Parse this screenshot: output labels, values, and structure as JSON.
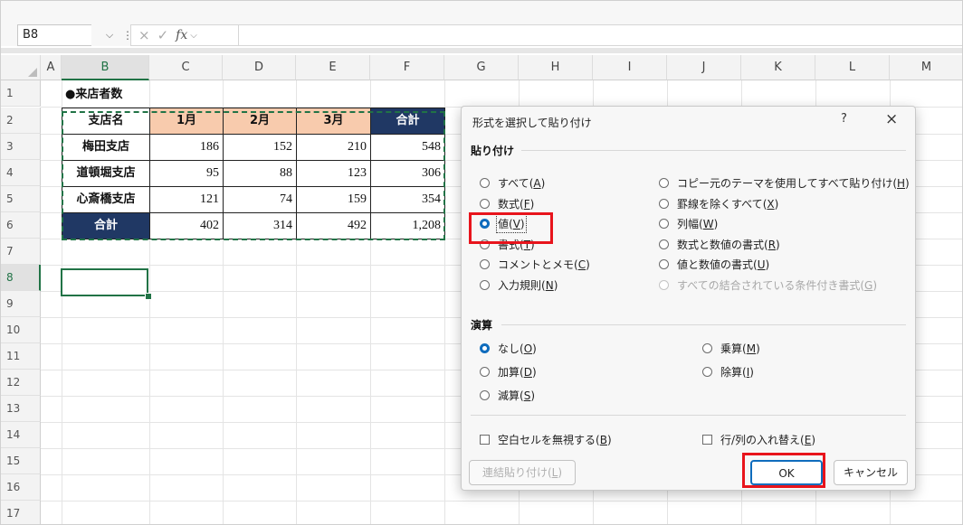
{
  "formula_bar": {
    "name_box": "B8",
    "cancel_icon": "×",
    "enter_icon": "✓",
    "fx_label": "fx",
    "formula_value": ""
  },
  "columns": [
    "A",
    "B",
    "C",
    "D",
    "E",
    "F",
    "G",
    "H",
    "I",
    "J",
    "K",
    "L",
    "M"
  ],
  "rows": [
    "1",
    "2",
    "3",
    "4",
    "5",
    "6",
    "7",
    "8",
    "9",
    "10",
    "11",
    "12",
    "13",
    "14",
    "15",
    "16",
    "17"
  ],
  "selected_cell": {
    "column": "B",
    "row": "8"
  },
  "table": {
    "title": "●来店者数",
    "headers": [
      "支店名",
      "1月",
      "2月",
      "3月",
      "合計"
    ],
    "rows": [
      [
        "梅田支店",
        "186",
        "152",
        "210",
        "548"
      ],
      [
        "道頓堀支店",
        "95",
        "88",
        "123",
        "306"
      ],
      [
        "心斎橋支店",
        "121",
        "74",
        "159",
        "354"
      ]
    ],
    "total_row": [
      "合計",
      "402",
      "314",
      "492",
      "1,208"
    ]
  },
  "dialog": {
    "title": "形式を選択して貼り付け",
    "help": "?",
    "close": "×",
    "paste_group": "貼り付け",
    "paste_left": [
      {
        "text": "すべて",
        "key": "A",
        "selected": false
      },
      {
        "text": "数式",
        "key": "F",
        "selected": false
      },
      {
        "text": "値",
        "key": "V",
        "selected": true
      },
      {
        "text": "書式",
        "key": "T",
        "selected": false
      },
      {
        "text": "コメントとメモ",
        "key": "C",
        "selected": false
      },
      {
        "text": "入力規則",
        "key": "N",
        "selected": false
      }
    ],
    "paste_right": [
      {
        "text": "コピー元のテーマを使用してすべて貼り付け",
        "key": "H",
        "selected": false,
        "disabled": false
      },
      {
        "text": "罫線を除くすべて",
        "key": "X",
        "selected": false,
        "disabled": false
      },
      {
        "text": "列幅",
        "key": "W",
        "selected": false,
        "disabled": false
      },
      {
        "text": "数式と数値の書式",
        "key": "R",
        "selected": false,
        "disabled": false
      },
      {
        "text": "値と数値の書式",
        "key": "U",
        "selected": false,
        "disabled": false
      },
      {
        "text": "すべての結合されている条件付き書式",
        "key": "G",
        "selected": false,
        "disabled": true
      }
    ],
    "operation_group": "演算",
    "operation_left": [
      {
        "text": "なし",
        "key": "O",
        "selected": true
      },
      {
        "text": "加算",
        "key": "D",
        "selected": false
      },
      {
        "text": "減算",
        "key": "S",
        "selected": false
      }
    ],
    "operation_right": [
      {
        "text": "乗算",
        "key": "M",
        "selected": false
      },
      {
        "text": "除算",
        "key": "I",
        "selected": false
      }
    ],
    "skip_blanks": {
      "text": "空白セルを無視する",
      "key": "B",
      "checked": false
    },
    "transpose": {
      "text": "行/列の入れ替え",
      "key": "E",
      "checked": false
    },
    "paste_link": {
      "text": "連結貼り付け",
      "key": "L"
    },
    "ok_label": "OK",
    "cancel_label": "キャンセル"
  },
  "colors": {
    "excel_green": "#217346",
    "month_header_fill": "#f8cbad",
    "total_fill": "#203864",
    "highlight_red": "#e8141c",
    "radio_blue": "#0f6cbd"
  }
}
